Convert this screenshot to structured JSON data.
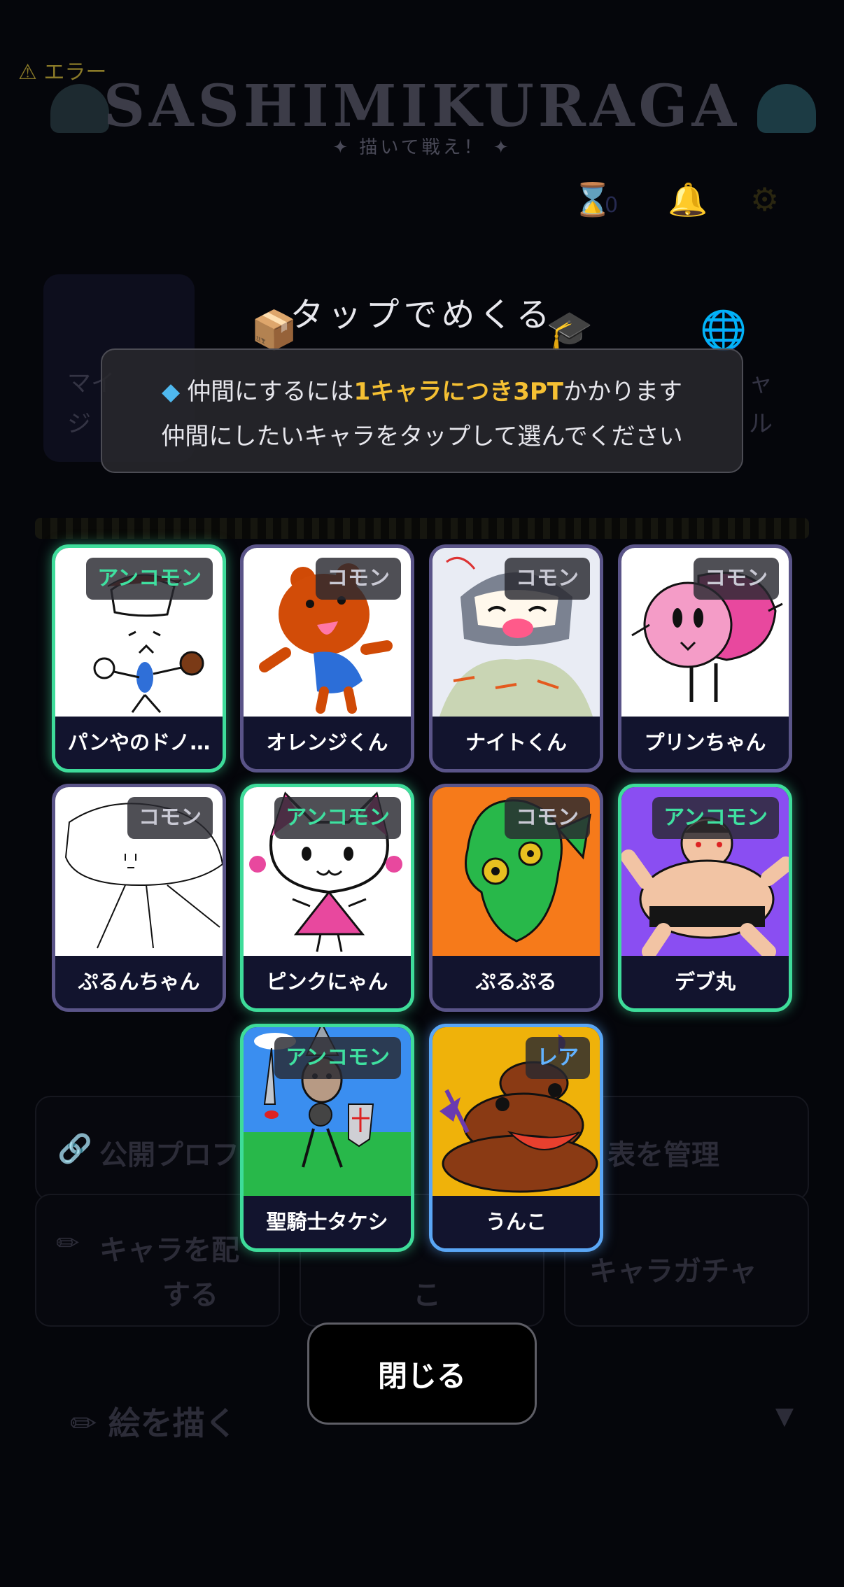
{
  "background": {
    "error_label": "⚠ エラー",
    "logo_title": "SASHIMIKURAGA",
    "logo_subtitle": "✦ 描いて戦え！ ✦",
    "hourglass_count": "0",
    "tile_left_label": "マイ",
    "tile_left_label2": "ジ",
    "tile_right_label": "ャ",
    "tile_right_label2": "ル",
    "btn_public_profile": "公開プロフ",
    "btn_manage": "表を管理",
    "btn_place_char": "キャラを配",
    "btn_place_char2": "する",
    "btn_mid": "こ",
    "btn_gacha": "キャラガチャ",
    "draw_label": "絵を描く",
    "draw_arrow": "▼"
  },
  "modal": {
    "title": "タップでめくる",
    "notice": {
      "prefix": "仲間にするには",
      "highlight": "1キャラにつき3PT",
      "suffix": "かかります",
      "line2": "仲間にしたいキャラをタップして選んでください"
    },
    "close_label": "閉じる"
  },
  "cards": [
    {
      "name": "パンやのドノ…",
      "rarity": "アンコモン",
      "tier": "uncommon",
      "art": "bakery",
      "bg": "#ffffff"
    },
    {
      "name": "オレンジくん",
      "rarity": "コモン",
      "tier": "common",
      "art": "orange",
      "bg": "#ffffff"
    },
    {
      "name": "ナイトくん",
      "rarity": "コモン",
      "tier": "common",
      "art": "knight",
      "bg": "#ffffff"
    },
    {
      "name": "プリンちゃん",
      "rarity": "コモン",
      "tier": "common",
      "art": "pudding",
      "bg": "#ffffff"
    },
    {
      "name": "ぷるんちゃん",
      "rarity": "コモン",
      "tier": "common",
      "art": "blob",
      "bg": "#ffffff"
    },
    {
      "name": "ピンクにゃん",
      "rarity": "アンコモン",
      "tier": "uncommon",
      "art": "cat",
      "bg": "#ffffff"
    },
    {
      "name": "ぷるぷる",
      "rarity": "コモン",
      "tier": "common",
      "art": "fish",
      "bg": "#f67a1a"
    },
    {
      "name": "デブ丸",
      "rarity": "アンコモン",
      "tier": "uncommon",
      "art": "sumo",
      "bg": "#8a4ef2"
    },
    {
      "name": "聖騎士タケシ",
      "rarity": "アンコモン",
      "tier": "uncommon",
      "art": "paladin",
      "bg": "#3a8ef0"
    },
    {
      "name": "うんこ",
      "rarity": "レア",
      "tier": "rare",
      "art": "poop",
      "bg": "#efb20a"
    }
  ],
  "colors": {
    "uncommon": "#3edc9a",
    "common": "#5a5488",
    "rare": "#5aa6f5",
    "highlight": "#f5c033"
  }
}
